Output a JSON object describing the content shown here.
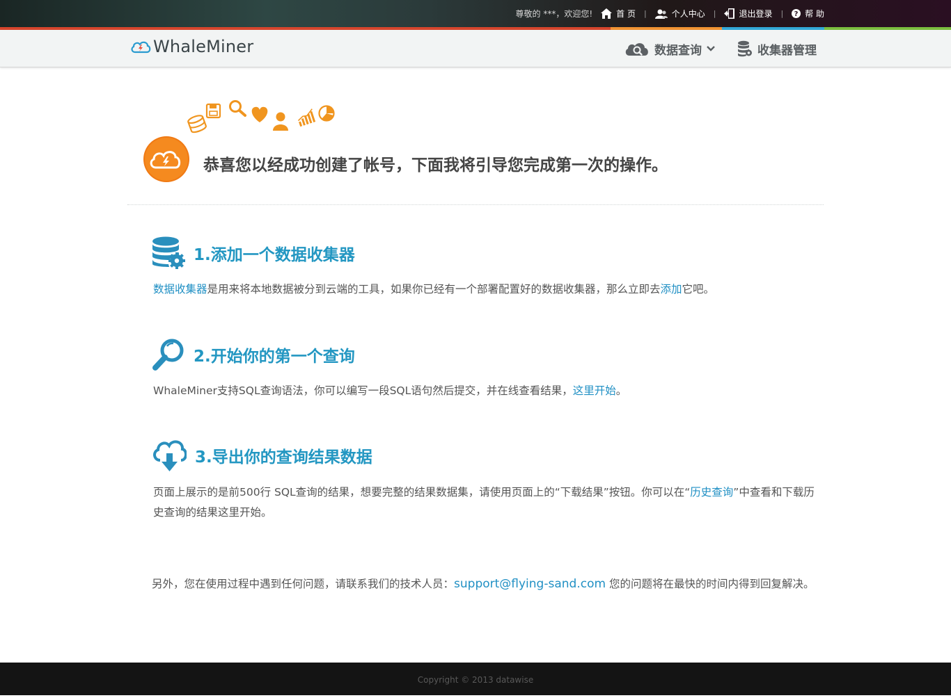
{
  "topbar": {
    "greeting": "尊敬的 ***，欢迎您!",
    "links": [
      {
        "label": "首 页",
        "icon": "home-icon"
      },
      {
        "label": "个人中心",
        "icon": "user-icon"
      },
      {
        "label": "退出登录",
        "icon": "logout-icon"
      },
      {
        "label": "帮 助",
        "icon": "help-icon"
      }
    ],
    "separator": "|"
  },
  "colorbar": {
    "colors": [
      "#d8462d",
      "#f29433",
      "#33a9d8",
      "#7cbf3f"
    ]
  },
  "navbar": {
    "logo_text": "WhaleMiner",
    "items": [
      {
        "label": "数据查询",
        "icon": "cloud-search-icon",
        "dropdown": true
      },
      {
        "label": "收集器管理",
        "icon": "database-gear-icon",
        "dropdown": false
      }
    ]
  },
  "welcome": {
    "title": "恭喜您以经成功创建了帐号，下面我将引导您完成第一次的操作。",
    "icons": [
      "database-icon",
      "save-icon",
      "search-icon",
      "heart-icon",
      "user-icon",
      "chart-icon",
      "pie-chart-icon"
    ]
  },
  "steps": [
    {
      "title": "1.添加一个数据收集器",
      "icon": "database-gear-icon",
      "text_link1": "数据收集器",
      "text_mid": "是用来将本地数据被分到云端的工具，如果你已经有一个部署配置好的数据收集器，那么立即去",
      "text_link2": "添加",
      "text_end": "它吧。"
    },
    {
      "title": "2.开始你的第一个查询",
      "icon": "magnifier-icon",
      "text_start": "WhaleMiner支持SQL查询语法，你可以编写一段SQL语句然后提交，并在线查看结果，",
      "text_link": "这里开始",
      "text_end": "。"
    },
    {
      "title": "3.导出你的查询结果数据",
      "icon": "cloud-download-icon",
      "text_start": "页面上展示的是前500行 SQL查询的结果，想要完整的结果数据集，请使用页面上的“下载结果”按钮。你可以在“",
      "text_link": "历史查询",
      "text_end": "”中查看和下载历史查询的结果这里开始。"
    }
  ],
  "extra": {
    "text_start": "另外，您在使用过程中遇到任何问题，请联系我们的技术人员：",
    "email": "support@flying-sand.com",
    "text_end": " 您的问题将在最快的时间内得到回复解决。"
  },
  "footer": {
    "copyright": "Copyright © 2013 datawise"
  }
}
